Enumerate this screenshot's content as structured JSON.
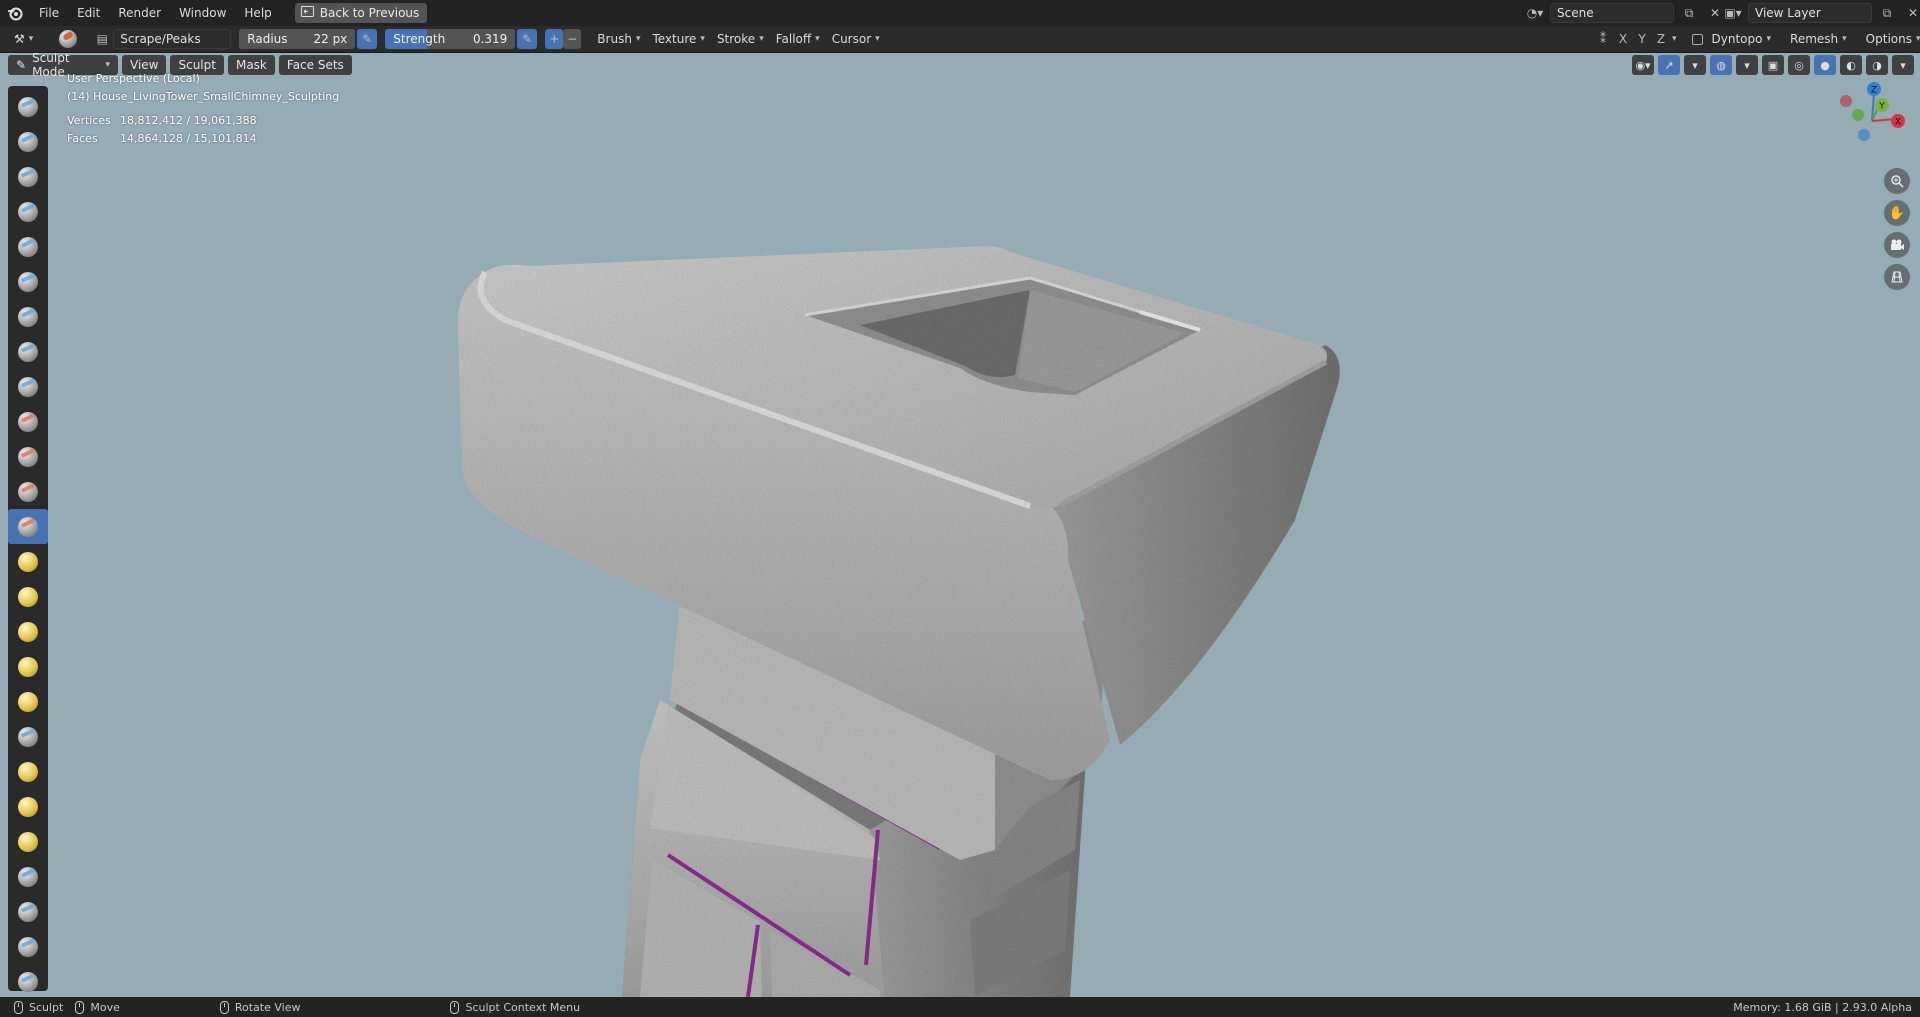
{
  "menubar": {
    "items": [
      "File",
      "Edit",
      "Render",
      "Window",
      "Help"
    ],
    "back_button": "Back to Previous",
    "scene_label": "Scene",
    "view_layer_label": "View Layer"
  },
  "toolheader": {
    "brush_name": "Scrape/Peaks",
    "radius_label": "Radius",
    "radius_value": "22 px",
    "strength_label": "Strength",
    "strength_value": "0.319",
    "strength_fraction": 0.319,
    "plus": "+",
    "minus": "−",
    "dropdowns": [
      "Brush",
      "Texture",
      "Stroke",
      "Falloff",
      "Cursor"
    ],
    "axes": [
      "X",
      "Y",
      "Z"
    ],
    "dyntopo": "Dyntopo",
    "remesh": "Remesh",
    "options": "Options"
  },
  "viewport_header": {
    "mode": "Sculpt Mode",
    "menus": [
      "View",
      "Sculpt",
      "Mask",
      "Face Sets"
    ]
  },
  "overlay": {
    "perspective": "User Perspective (Local)",
    "object": "(14) House_LivingTower_SmallChimney_Sculpting",
    "vertices_label": "Vertices",
    "vertices_value": "18,812,412 / 19,061,388",
    "faces_label": "Faces",
    "faces_value": "14,864,128 / 15,101,814"
  },
  "gizmo": {
    "z": "Z",
    "y": "Y",
    "x": "X"
  },
  "statusbar": {
    "sculpt": "Sculpt",
    "move": "Move",
    "rotate": "Rotate View",
    "context": "Sculpt Context Menu",
    "memory": "Memory: 1.68 GiB | 2.93.0 Alpha"
  },
  "colors": {
    "accent": "#4772b3",
    "viewport_bg": "#95acb5",
    "seam": "#8a2b8c",
    "stone": "#b5b5b5"
  }
}
